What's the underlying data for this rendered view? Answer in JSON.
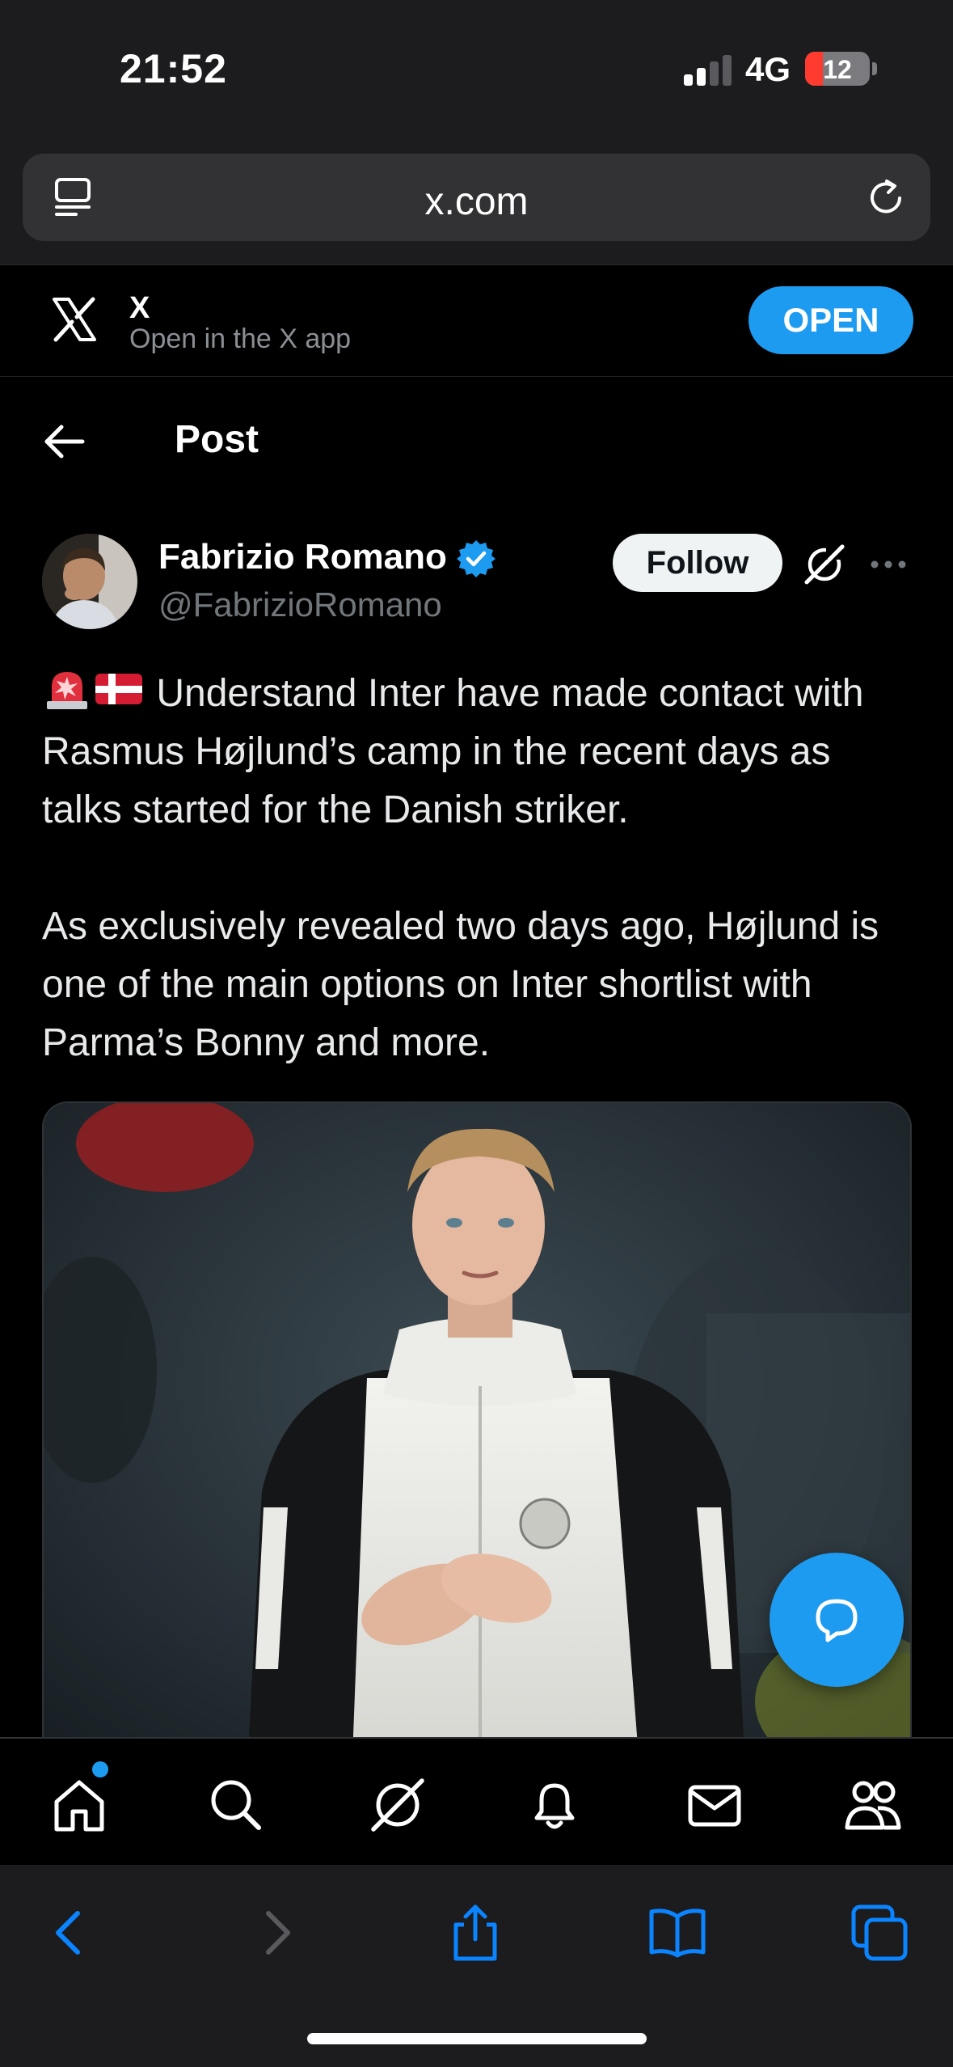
{
  "status_bar": {
    "time": "21:52",
    "network": "4G",
    "battery": "12",
    "battery_level": 0.12,
    "signal_bars": 2
  },
  "browser": {
    "url": "x.com",
    "icons": {
      "reader": "reader-mode-icon",
      "reload": "reload-icon"
    }
  },
  "app_banner": {
    "name": "X",
    "subtitle": "Open in the X app",
    "open_label": "OPEN"
  },
  "post_header": {
    "title": "Post"
  },
  "post": {
    "author_name": "Fabrizio Romano",
    "author_handle": "@FabrizioRomano",
    "follow_label": "Follow",
    "paragraph_1": "Understand Inter have made contact with Rasmus Højlund’s camp in the recent days as talks started for the Danish striker.",
    "paragraph_2": "As exclusively revealed two days ago, Højlund is one of the main options on Inter shortlist with Parma’s Bonny and more.",
    "emojis": [
      "rotating-light-emoji",
      "denmark-flag-emoji"
    ]
  },
  "bottom_nav": {
    "items": [
      "home-icon",
      "search-icon",
      "grok-icon",
      "notifications-icon",
      "messages-icon",
      "communities-icon"
    ],
    "active": "home-icon"
  },
  "safari_toolbar": {
    "items": [
      "back-icon",
      "forward-icon",
      "share-icon",
      "bookmarks-icon",
      "tabs-icon"
    ]
  },
  "colors": {
    "accent": "#1d9bf0",
    "background": "#000000",
    "chrome": "#1c1c1e"
  }
}
